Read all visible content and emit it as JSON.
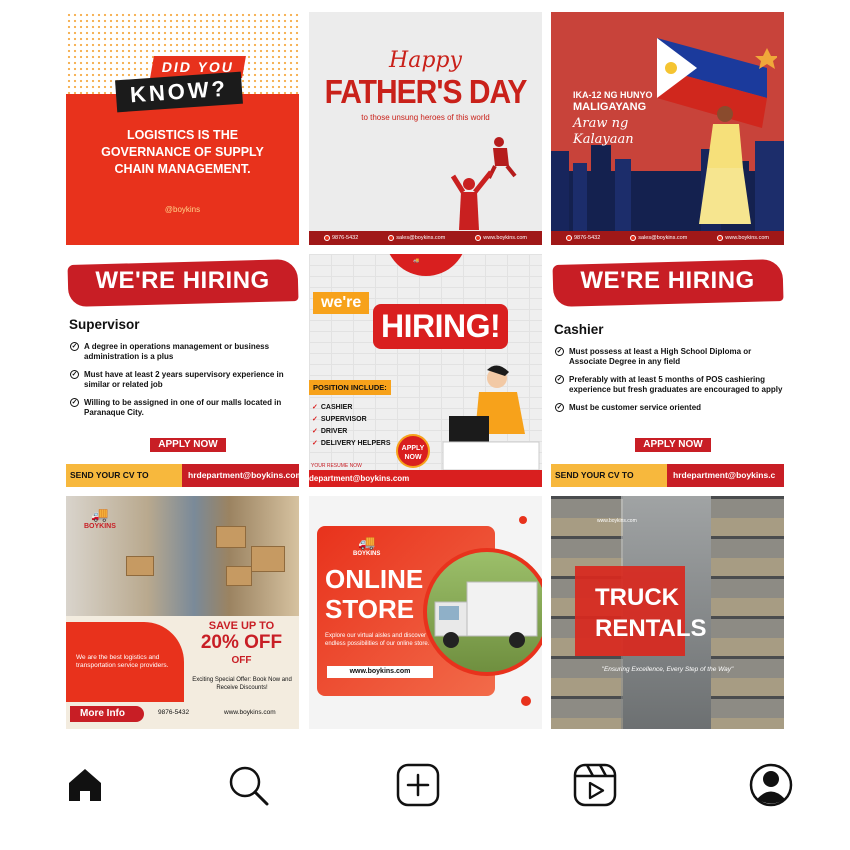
{
  "posts": {
    "did_you_know": {
      "did": "DID YOU",
      "know": "KNOW?",
      "body": "LOGISTICS IS THE GOVERNANCE OF SUPPLY CHAIN MANAGEMENT.",
      "handle": "@boykins"
    },
    "fathers_day": {
      "happy": "Happy",
      "title": "FATHER'S DAY",
      "subtitle": "to those unsung heroes of this world",
      "footer_phone": "9876-5432",
      "footer_email": "sales@boykins.com",
      "footer_web": "www.boykins.com"
    },
    "kalayaan": {
      "line1": "IKA-12 NG HUNYO",
      "line2": "MALIGAYANG",
      "line3": "Araw ng Kalayaan",
      "footer_phone": "9876-5432",
      "footer_email": "sales@boykins.com",
      "footer_web": "www.boykins.com"
    },
    "hiring_supervisor": {
      "banner": "WE'RE HIRING",
      "position": "Supervisor",
      "requirements": [
        "A degree in operations management or business administration is a plus",
        "Must have at least 2 years supervisory experience in similar or related job",
        "Willing to be assigned in one of our malls located in Paranaque City."
      ],
      "apply": "APPLY NOW",
      "send_cv": "SEND YOUR CV TO",
      "email": "hrdepartment@boykins.com"
    },
    "hiring_illustrated": {
      "were": "we're",
      "hiring": "HIRING!",
      "position_include": "POSITION INCLUDE:",
      "positions": [
        "CASHIER",
        "SUPERVISOR",
        "DRIVER",
        "DELIVERY HELPERS"
      ],
      "apply": "APPLY NOW",
      "resume_label": "YOUR RESUME NOW",
      "email": "department@boykins.com"
    },
    "hiring_cashier": {
      "banner": "WE'RE HIRING",
      "position": "Cashier",
      "requirements": [
        "Must possess at least a High School Diploma or Associate Degree in any field",
        "Preferably with at least 5 months of POS cashiering experience but fresh graduates are encouraged to apply",
        "Must be customer service oriented"
      ],
      "apply": "APPLY NOW",
      "send_cv": "SEND YOUR CV TO",
      "email": "hrdepartment@boykins.c"
    },
    "delivery_promo": {
      "brand": "BOYKINS",
      "tagline": "We are the best logistics and transportation service providers.",
      "save": "SAVE UP TO",
      "percent": "20% OFF",
      "off": "OFF",
      "offer": "Exciting Special Offer: Book Now and Receive Discounts!",
      "more_info": "More Info",
      "phone": "9876-5432",
      "web": "www.boykins.com"
    },
    "online_store": {
      "brand": "BOYKINS",
      "title_line1": "ONLINE",
      "title_line2": "STORE",
      "description": "Explore our virtual aisles and discover the endless possibilities of our online store.",
      "url": "www.boykins.com"
    },
    "truck_rentals": {
      "site": "www.boykins.com",
      "title_line1": "TRUCK",
      "title_line2": "RENTALS",
      "motto": "\"Ensuring Excellence, Every Step of the Way\""
    }
  },
  "nav": {
    "items": [
      {
        "icon": "home-icon"
      },
      {
        "icon": "search-icon"
      },
      {
        "icon": "create-icon"
      },
      {
        "icon": "reels-icon"
      },
      {
        "icon": "profile-icon"
      }
    ]
  },
  "colors": {
    "brand_red": "#c81e25",
    "accent_orange": "#f7a21b",
    "nav_icon": "#111111"
  }
}
